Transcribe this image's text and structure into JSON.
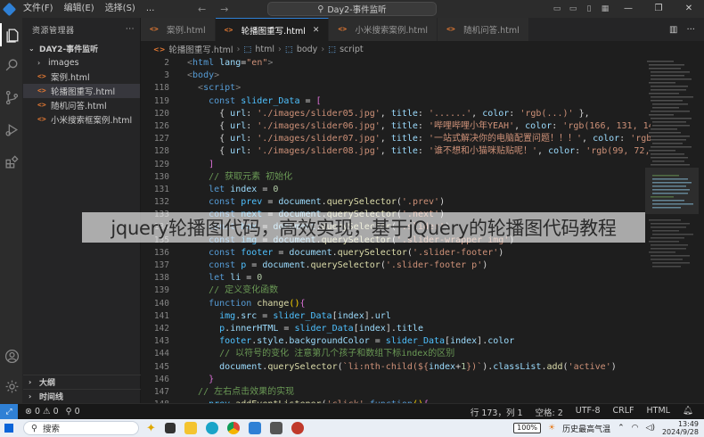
{
  "titlebar": {
    "menu": [
      "文件(F)",
      "编辑(E)",
      "选择(S)",
      "..."
    ],
    "command_center": "Day2-事件监听"
  },
  "sidebar": {
    "header": "资源管理器",
    "project": "DAY2-事件监听",
    "items": [
      {
        "label": "images",
        "type": "folder"
      },
      {
        "label": "案例.html",
        "type": "html"
      },
      {
        "label": "轮播图重写.html",
        "type": "html",
        "selected": true
      },
      {
        "label": "随机问答.html",
        "type": "html"
      },
      {
        "label": "小米搜索框案例.html",
        "type": "html"
      }
    ],
    "outline": "大纲",
    "timeline": "时间线"
  },
  "tabs": [
    {
      "label": "案例.html",
      "active": false
    },
    {
      "label": "轮播图重写.html",
      "active": true
    },
    {
      "label": "小米搜索案例.html",
      "active": false
    },
    {
      "label": "随机问答.html",
      "active": false
    }
  ],
  "breadcrumb": [
    "轮播图重写.html",
    "html",
    "body",
    "script"
  ],
  "editor": {
    "line_numbers": [
      "2",
      "3",
      "118",
      "119",
      "120",
      "126",
      "127",
      "128",
      "129",
      "130",
      "131",
      "132",
      "133",
      "134",
      "135",
      "136",
      "137",
      "138",
      "139",
      "140",
      "141",
      "142",
      "143",
      "144",
      "145",
      "146",
      "147",
      "148"
    ]
  },
  "overlay_text": "jquery轮播图代码，高效实现，基于jQuery的轮播图代码教程",
  "statusbar": {
    "errors": "⊗ 0 ⚠ 0",
    "ports": "⚲ 0",
    "position": "行 173，列 1",
    "spaces": "空格: 2",
    "encoding": "UTF-8",
    "eol": "CRLF",
    "language": "HTML"
  },
  "taskbar": {
    "search_placeholder": "搜索",
    "battery": "100%",
    "weather": "历史最高气温",
    "time": "13:49",
    "date": "2024/9/28"
  }
}
